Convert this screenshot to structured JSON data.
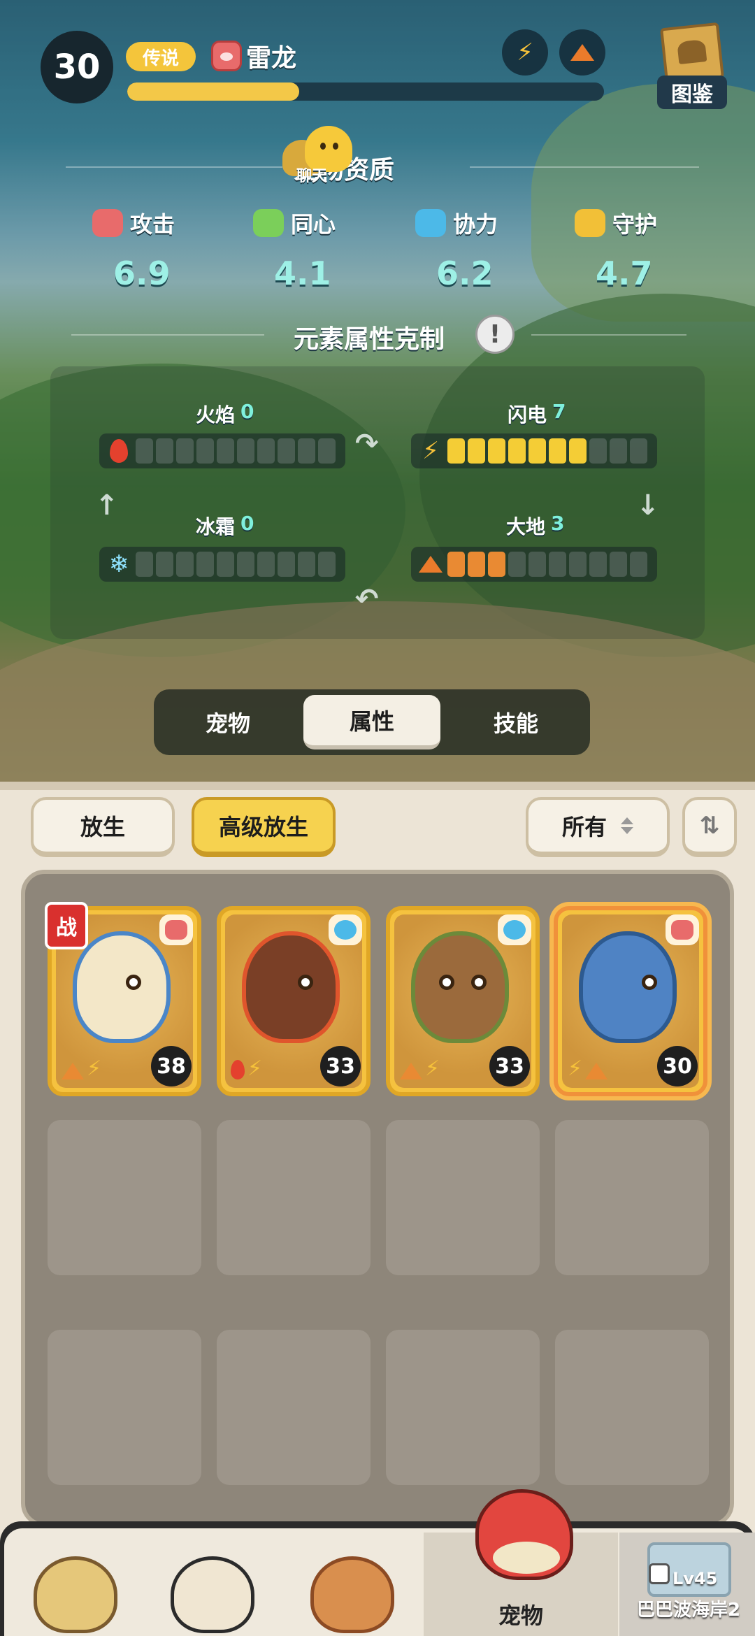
{
  "header": {
    "level": "30",
    "rarity": "传说",
    "pet_name": "雷龙",
    "xp_fraction": 0.36,
    "quick_icons": [
      "lightning-icon",
      "earth-icon"
    ],
    "codex_label": "图鉴"
  },
  "aptitude": {
    "chat_label": "聊天",
    "title": "宠物资质",
    "stats": [
      {
        "label": "攻击",
        "value": "6.9",
        "icon": "attack-icon",
        "color": "#e86b6b"
      },
      {
        "label": "同心",
        "value": "4.1",
        "icon": "heart-icon",
        "color": "#7bcf5a"
      },
      {
        "label": "协力",
        "value": "6.2",
        "icon": "cooperation-icon",
        "color": "#4cb9e8"
      },
      {
        "label": "守护",
        "value": "4.7",
        "icon": "guard-icon",
        "color": "#f2c037"
      }
    ]
  },
  "elements": {
    "title": "元素属性克制",
    "items": [
      {
        "label": "火焰",
        "value": "0",
        "filled": 0,
        "total": 10
      },
      {
        "label": "闪电",
        "value": "7",
        "filled": 7,
        "total": 10
      },
      {
        "label": "冰霜",
        "value": "0",
        "filled": 0,
        "total": 10
      },
      {
        "label": "大地",
        "value": "3",
        "filled": 3,
        "total": 10
      }
    ]
  },
  "tabs": [
    {
      "label": "宠物",
      "active": false
    },
    {
      "label": "属性",
      "active": true
    },
    {
      "label": "技能",
      "active": false
    }
  ],
  "toolbar": {
    "release": "放生",
    "advanced_release": "高级放生",
    "filter": "所有"
  },
  "pets": [
    {
      "level": "38",
      "type": "attack",
      "elements": [
        "earth",
        "lightning"
      ],
      "in_battle": true,
      "selected": false
    },
    {
      "level": "33",
      "type": "cooperation",
      "elements": [
        "fire",
        "lightning"
      ],
      "in_battle": false,
      "selected": false
    },
    {
      "level": "33",
      "type": "cooperation",
      "elements": [
        "earth",
        "lightning"
      ],
      "in_battle": false,
      "selected": false
    },
    {
      "level": "30",
      "type": "attack",
      "elements": [
        "lightning",
        "earth"
      ],
      "in_battle": false,
      "selected": true
    }
  ],
  "battle_badge": "战",
  "nav": {
    "active_label": "宠物",
    "locked": {
      "level": "Lv45",
      "name": "巴巴波海岸2"
    }
  }
}
